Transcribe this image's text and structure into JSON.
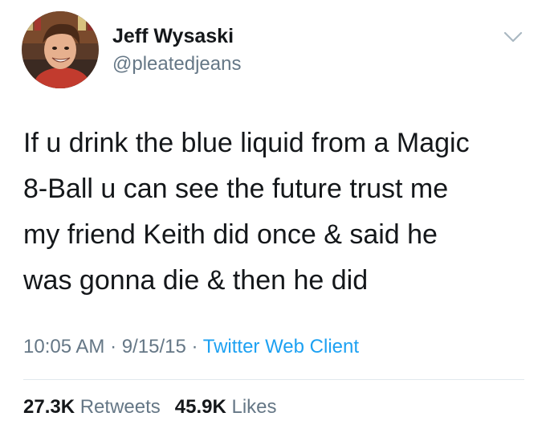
{
  "author": {
    "name": "Jeff Wysaski",
    "handle": "@pleatedjeans"
  },
  "tweet": {
    "lines": [
      "If u drink the blue liquid from a Magic",
      "8-Ball u can see the future trust me",
      "my friend Keith did once & said he",
      "was gonna die & then he did"
    ]
  },
  "meta": {
    "time": "10:05 AM",
    "separator": "·",
    "date": "9/15/15",
    "source": "Twitter Web Client"
  },
  "stats": {
    "retweets_count": "27.3K",
    "retweets_label": "Retweets",
    "likes_count": "45.9K",
    "likes_label": "Likes"
  },
  "icons": {
    "menu": "chevron-down-icon"
  },
  "colors": {
    "text": "#14171a",
    "secondary": "#657786",
    "link": "#1da1f2",
    "divider": "#e1e8ed"
  }
}
